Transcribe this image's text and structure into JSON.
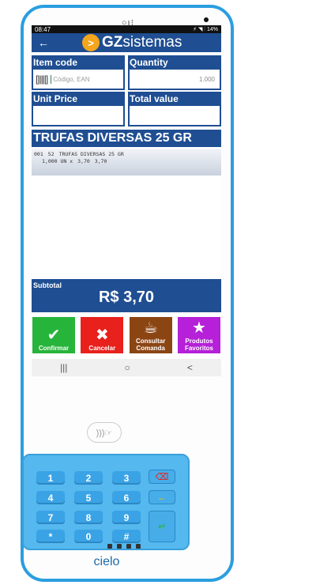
{
  "status_bar": {
    "time": "08:47",
    "right_status": "⚡ ◥ ⫶ 14%"
  },
  "header": {
    "logo_badge": ">",
    "logo_bold": "GZ",
    "logo_light": "sistemas"
  },
  "form": {
    "item_code_label": "Item code",
    "item_code_placeholder": "Código, EAN",
    "quantity_label": "Quantity",
    "quantity_value": "1.000",
    "unit_price_label": "Unit Price",
    "unit_price_value": "",
    "total_value_label": "Total value",
    "total_value_value": ""
  },
  "product": {
    "name": "TRUFAS DIVERSAS 25 GR"
  },
  "receipt": {
    "line1": [
      "001",
      "52",
      "TRUFAS DIVERSAS 25 GR"
    ],
    "line2": [
      "1,000 UN x",
      "3,70",
      "3,70"
    ]
  },
  "subtotal": {
    "label": "Subtotal",
    "value": "R$ 3,70"
  },
  "actions": {
    "confirm": "Confirmar",
    "cancel": "Cancelar",
    "comanda_1": "Consultar",
    "comanda_2": "Comanda",
    "fav_1": "Produtos",
    "fav_2": "Favoritos"
  },
  "keypad": {
    "k1": "1",
    "k2": "2",
    "k3": "3",
    "k4": "4",
    "k5": "5",
    "k6": "6",
    "k7": "7",
    "k8": "8",
    "k9": "9",
    "kstar": "*",
    "k0": "0",
    "khash": "#"
  },
  "brand": "cielo",
  "colors": {
    "primary": "#1f4e92",
    "confirm": "#27b43a",
    "cancel": "#e8211d",
    "comanda": "#8b4513",
    "favorites": "#b520d8",
    "device": "#2a9ee0"
  }
}
